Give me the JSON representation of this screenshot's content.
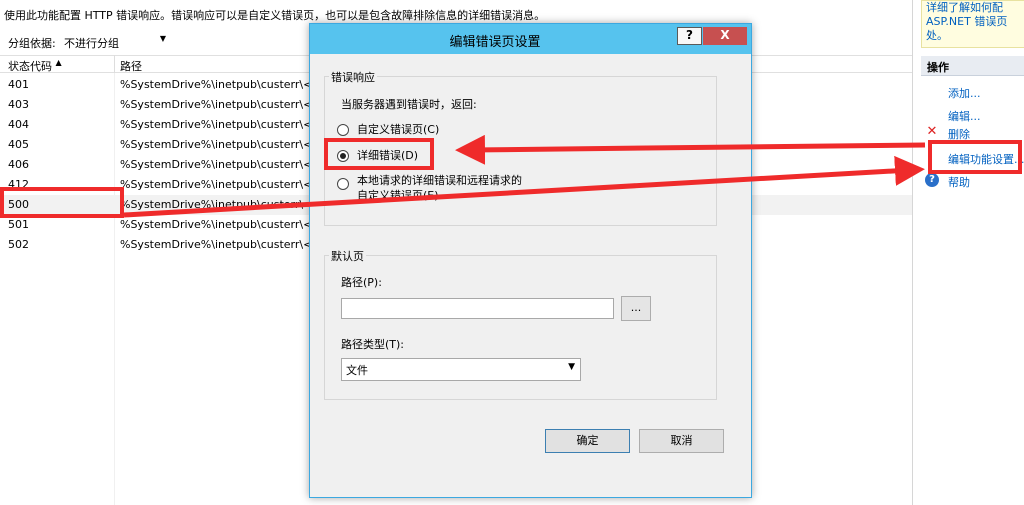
{
  "main": {
    "description": "使用此功能配置 HTTP 错误响应。错误响应可以是自定义错误页，也可以是包含故障排除信息的详细错误消息。",
    "group_label": "分组依据:",
    "group_value": "不进行分组",
    "columns": [
      "状态代码",
      "路径"
    ],
    "rows": [
      {
        "code": "401",
        "path": "%SystemDrive%\\inetpub\\custerr\\<"
      },
      {
        "code": "403",
        "path": "%SystemDrive%\\inetpub\\custerr\\<"
      },
      {
        "code": "404",
        "path": "%SystemDrive%\\inetpub\\custerr\\<"
      },
      {
        "code": "405",
        "path": "%SystemDrive%\\inetpub\\custerr\\<"
      },
      {
        "code": "406",
        "path": "%SystemDrive%\\inetpub\\custerr\\<"
      },
      {
        "code": "412",
        "path": "%SystemDrive%\\inetpub\\custerr\\<"
      },
      {
        "code": "500",
        "path": "%SystemDrive%\\inetpub\\custerr\\<"
      },
      {
        "code": "501",
        "path": "%SystemDrive%\\inetpub\\custerr\\<"
      },
      {
        "code": "502",
        "path": "%SystemDrive%\\inetpub\\custerr\\<"
      }
    ]
  },
  "right_panel": {
    "info_lines": [
      "详细了解如何配",
      "ASP.NET 错误页",
      "处。"
    ],
    "actions_title": "操作",
    "actions": {
      "add": "添加...",
      "edit": "编辑...",
      "delete": "删除",
      "edit_feature": "编辑功能设置...",
      "help": "帮助"
    }
  },
  "dialog": {
    "title": "编辑错误页设置",
    "help_glyph": "?",
    "close_glyph": "X",
    "error_group_title": "错误响应",
    "error_prompt": "当服务器遇到错误时，返回:",
    "options": [
      {
        "label": "自定义错误页(C)",
        "selected": false
      },
      {
        "label": "详细错误(D)",
        "selected": true
      },
      {
        "label": "本地请求的详细错误和远程请求的",
        "label2": "自定义错误页(E)",
        "selected": false
      }
    ],
    "default_group_title": "默认页",
    "path_label": "路径(P):",
    "path_value": "",
    "browse_label": "...",
    "path_type_label": "路径类型(T):",
    "path_type_value": "文件",
    "ok_label": "确定",
    "cancel_label": "取消"
  },
  "colors": {
    "titlebar": "#56c3ee",
    "highlight": "#ef2b2b",
    "link": "#0060c0"
  }
}
